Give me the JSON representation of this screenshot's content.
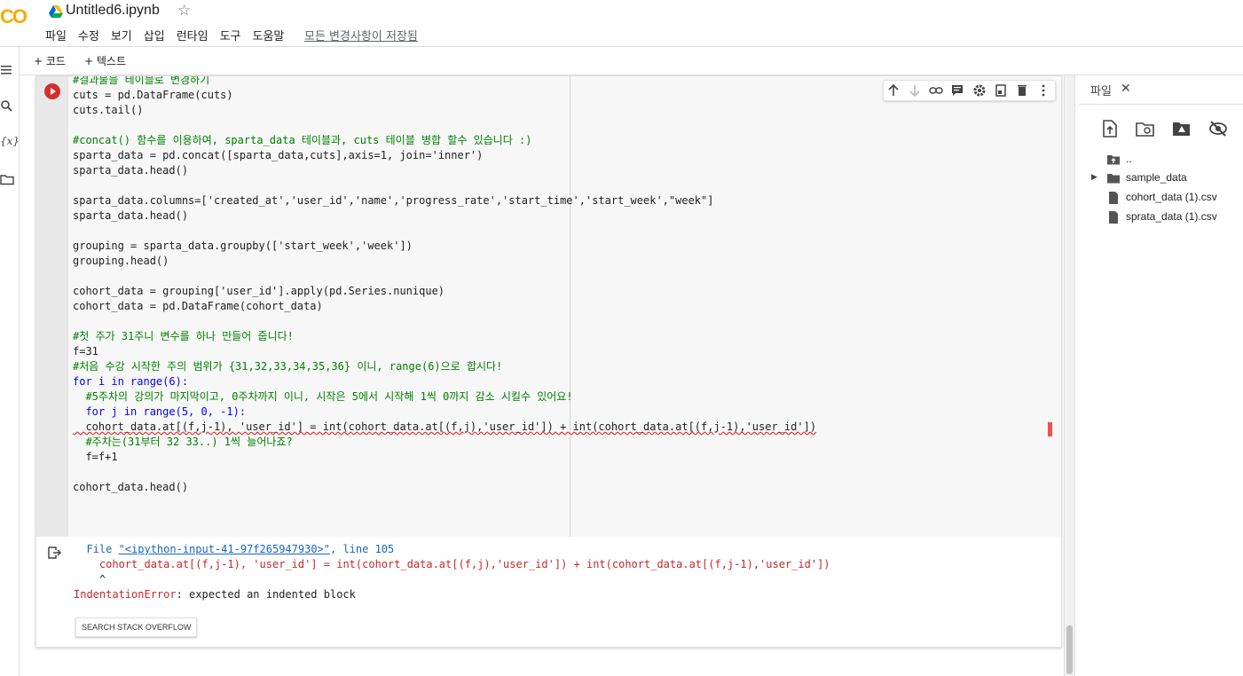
{
  "header": {
    "logo": "CO",
    "title": "Untitled6.ipynb",
    "menu": [
      "파일",
      "수정",
      "보기",
      "삽입",
      "런타임",
      "도구",
      "도움말"
    ],
    "save_status": "모든 변경사항이 저장됨"
  },
  "toolbar": {
    "add_code": "+ 코드",
    "add_text": "+ 텍스트"
  },
  "rail_icons": [
    "menu-icon",
    "search-icon",
    "variables-icon",
    "folder-icon"
  ],
  "variables_icon_text": "{x}",
  "cell": {
    "code_lines": [
      "#결과물을 테이블로 변경하기",
      "cuts = pd.DataFrame(cuts)",
      "cuts.tail()",
      "",
      "#concat() 함수를 이용하여, sparta_data 테이블과, cuts 테이블 병합 할수 있습니다 :)",
      "sparta_data = pd.concat([sparta_data,cuts],axis=1, join='inner')",
      "sparta_data.head()",
      "",
      "sparta_data.columns=['created_at','user_id','name','progress_rate','start_time','start_week',\"week\"]",
      "sparta_data.head()",
      "",
      "grouping = sparta_data.groupby(['start_week','week'])",
      "grouping.head()",
      "",
      "cohort_data = grouping['user_id'].apply(pd.Series.nunique)",
      "cohort_data = pd.DataFrame(cohort_data)",
      "",
      "#첫 주가 31주니 변수를 하나 만들어 줍니다!",
      "f=31",
      "#처음 수강 시작한 주의 범위가 {31,32,33,34,35,36} 이니, range(6)으로 합시다!",
      "for i in range(6):",
      "  #5주차의 강의가 마지막이고, 0주차까지 이니, 시작은 5에서 시작해 1씩 0까지 감소 시킬수 있어요!",
      "  for j in range(5, 0, -1):",
      "  cohort_data.at[(f,j-1), 'user_id'] = int(cohort_data.at[(f,j),'user_id']) + int(cohort_data.at[(f,j-1),'user_id'])",
      "  #주차는(31부터 32 33..) 1씩 늘어나죠?",
      "  f=f+1",
      "",
      "cohort_data.head()"
    ],
    "tools": [
      "arrow-up-icon",
      "arrow-down-icon",
      "link-icon",
      "comment-icon",
      "settings-icon",
      "mirror-cell-icon",
      "delete-icon",
      "more-vert-icon"
    ]
  },
  "output": {
    "file_prefix": "File ",
    "file_link": "\"<ipython-input-41-97f265947930>\"",
    "file_suffix": ", line 105",
    "code_line": "cohort_data.at[(f,j-1), 'user_id'] = int(cohort_data.at[(f,j),'user_id']) + int(cohort_data.at[(f,j-1),'user_id'])",
    "caret": "^",
    "error_type": "IndentationError",
    "error_msg": ": expected an indented block",
    "so_button": "SEARCH STACK OVERFLOW"
  },
  "files_panel": {
    "title": "파일",
    "actions": [
      "upload-icon",
      "refresh-icon",
      "mount-drive-icon",
      "hide-files-icon"
    ],
    "tree": [
      {
        "name": "..",
        "type": "parent-folder"
      },
      {
        "name": "sample_data",
        "type": "folder"
      },
      {
        "name": "cohort_data (1).csv",
        "type": "file"
      },
      {
        "name": "sprata_data (1).csv",
        "type": "file"
      }
    ]
  }
}
